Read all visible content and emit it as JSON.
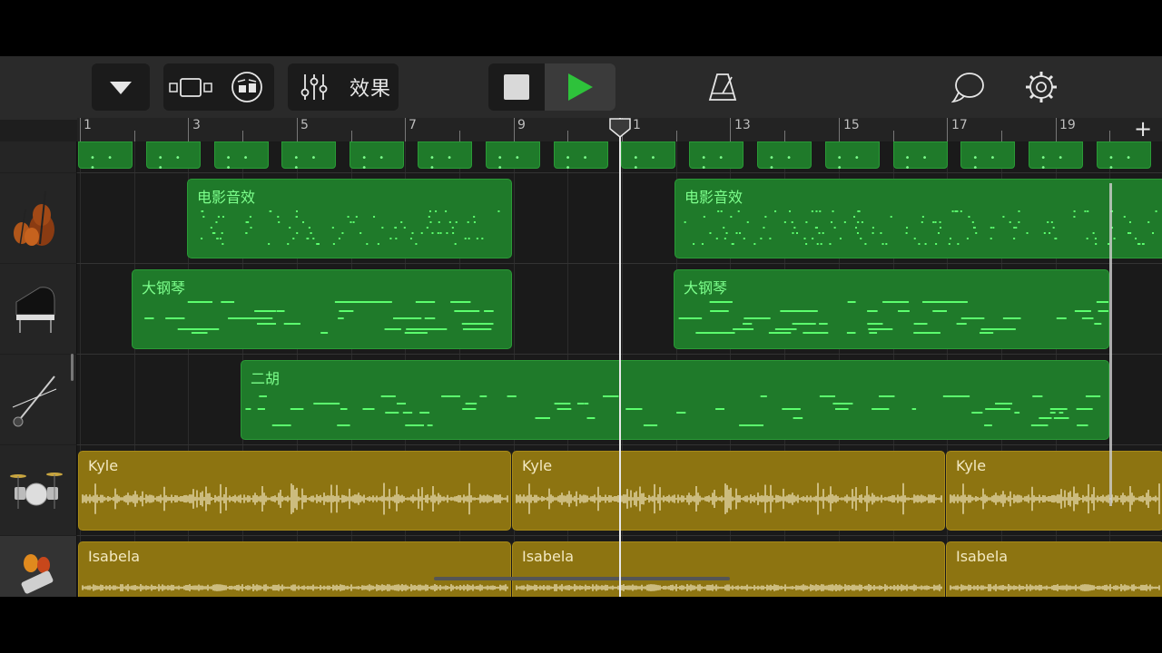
{
  "toolbar": {
    "browser_icon": "chevron-down-icon",
    "tracks_view_icon": "tracks-view-icon",
    "instrument_icon": "drum-instrument-icon",
    "mixer_icon": "mixer-sliders-icon",
    "fx_label": "效果",
    "stop_icon": "stop-icon",
    "play_icon": "play-icon",
    "metronome_icon": "metronome-icon",
    "loop_icon": "loop-browser-icon",
    "settings_icon": "gear-icon",
    "add_icon": "+"
  },
  "ruler": {
    "bars": [
      "1",
      "3",
      "5",
      "7",
      "9",
      "1",
      "13",
      "15",
      "17",
      "19"
    ]
  },
  "tracks": [
    {
      "icon": "drum-machine-track-icon",
      "regions": []
    },
    {
      "icon": "strings-track-icon",
      "regions": [
        {
          "title": "电影音效"
        },
        {
          "title": "电影音效"
        }
      ]
    },
    {
      "icon": "grand-piano-track-icon",
      "regions": [
        {
          "title": "大钢琴"
        },
        {
          "title": "大钢琴"
        }
      ]
    },
    {
      "icon": "erhu-track-icon",
      "regions": [
        {
          "title": "二胡"
        }
      ]
    },
    {
      "icon": "drum-kit-track-icon",
      "regions": [
        {
          "title": "Kyle"
        },
        {
          "title": "Kyle"
        },
        {
          "title": "Kyle"
        }
      ]
    },
    {
      "icon": "shaker-track-icon",
      "regions": [
        {
          "title": "Isabela"
        },
        {
          "title": "Isabela"
        },
        {
          "title": "Isabela"
        }
      ]
    }
  ],
  "colors": {
    "midi_region": "#1f7a2a",
    "midi_note": "#5cff6e",
    "audio_region": "#8d7411",
    "play_button": "#2ec23b"
  }
}
